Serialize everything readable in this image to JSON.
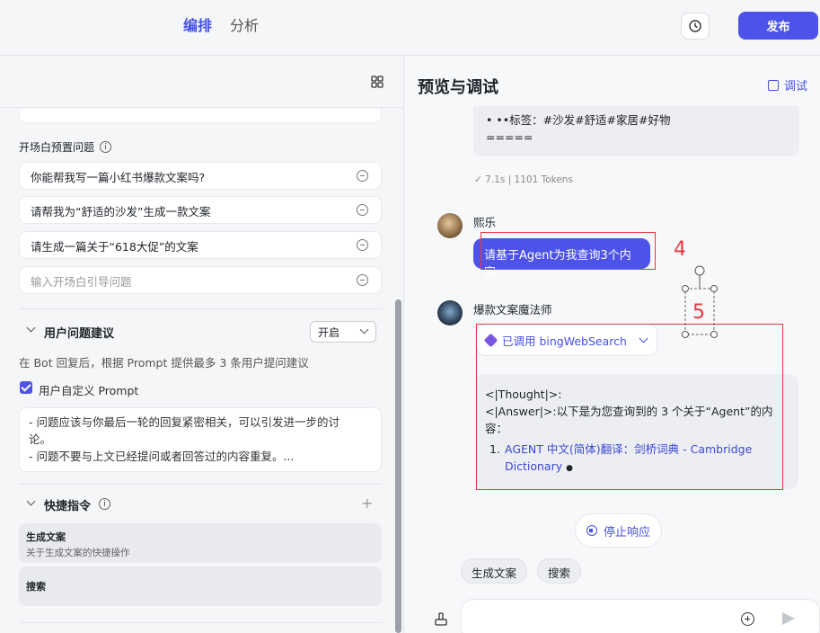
{
  "header": {
    "tabs": [
      "编排",
      "分析"
    ],
    "publish_label": "发布"
  },
  "left": {
    "preset_questions_label": "开场白预置问题",
    "preset_questions": [
      "你能帮我写一篇小红书爆款文案吗?",
      "请帮我为“舒适的沙发”生成一款文案",
      "请生成一篇关于“618大促”的文案"
    ],
    "question_placeholder": "输入开场白引导问题",
    "user_suggestions_title": "用户问题建议",
    "suggestions_toggle": "开启",
    "suggestions_desc": "在 Bot 回复后，根据 Prompt 提供最多 3 条用户提问建议",
    "custom_prompt_label": "用户自定义 Prompt",
    "prompt_lines": [
      "- 问题应该与你最后一轮的回复紧密相关，可以引发进一步的讨",
      "论。",
      "- 问题不要与上文已经提问或者回答过的内容重复。..."
    ],
    "shortcuts_title": "快捷指令",
    "shortcuts": [
      {
        "name": "生成文案",
        "desc": "关于生成文案的快捷操作"
      },
      {
        "name": "搜索",
        "desc": ""
      }
    ]
  },
  "right": {
    "title": "预览与调试",
    "debug_label": "调试",
    "prev_lines": [
      "• ••标签：#沙发#舒适#家居#好物",
      "====="
    ],
    "meta": "7.1s  |  1101 Tokens",
    "user_name": "熙乐",
    "user_message": "请基于Agent为我查询3个内容",
    "bot_name": "爆款文案魔法师",
    "plugin_label": "已调用 bingWebSearch",
    "answer_line1": "<|Thought|>:",
    "answer_line2": "<|Answer|>:以下是为您查询到的 3 个关于“Agent”的内",
    "answer_line3": "容：",
    "answer_item_num": "1.",
    "answer_link1": "AGENT 中文(简体)翻译：剑桥词典 - Cambridge",
    "answer_link2": "Dictionary",
    "stop_label": "停止响应",
    "suggestions": [
      "生成文案",
      "搜索"
    ],
    "annotation_4": "4",
    "annotation_5": "5"
  }
}
